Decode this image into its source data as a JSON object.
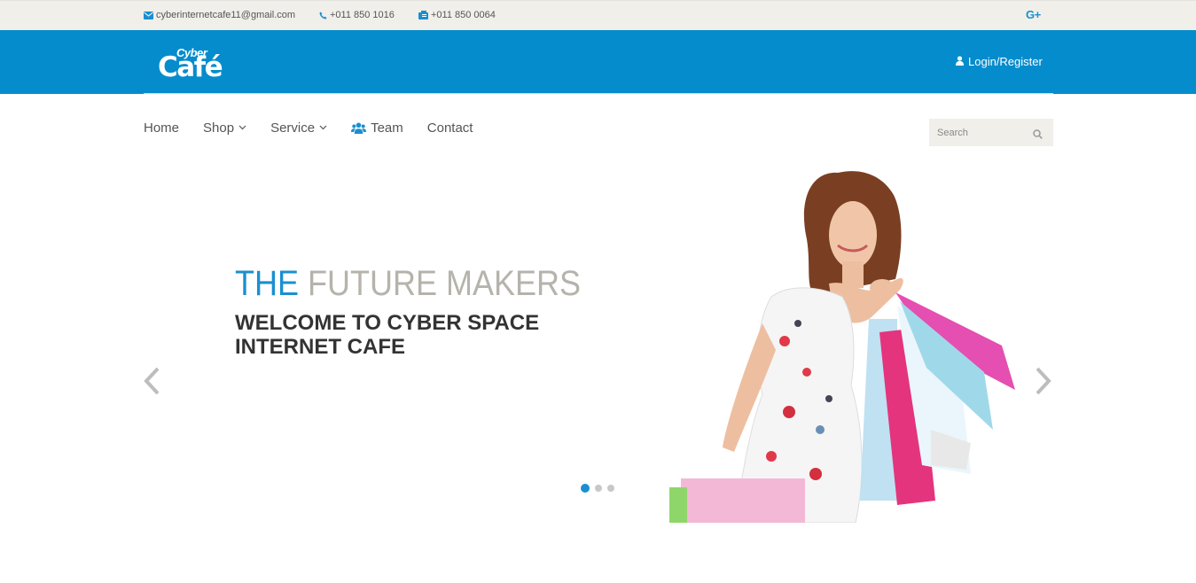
{
  "topbar": {
    "email": "cyberinternetcafe11@gmail.com",
    "phone": "+011 850 1016",
    "fax": "+011 850 0064",
    "social_icon": "google-plus-icon",
    "social_label": "G+"
  },
  "header": {
    "logo_small": "Cyber",
    "logo_big": "Café",
    "login_label": "Login/Register",
    "brand_color": "#058ccd"
  },
  "nav": {
    "items": [
      {
        "label": "Home"
      },
      {
        "label": "Shop"
      },
      {
        "label": "Service"
      },
      {
        "label": "Team"
      },
      {
        "label": "Contact"
      }
    ]
  },
  "search": {
    "placeholder": "Search",
    "value": ""
  },
  "hero": {
    "title_part1": "THE",
    "title_part2": "FUTURE MAKERS",
    "subtitle": "WELCOME TO CYBER SPACE INTERNET CAFE",
    "slides_total": 3,
    "active_slide": 1
  },
  "colors": {
    "accent": "#1a8fd0",
    "topbar_bg": "#f0efea",
    "title_grey": "#b5b3ab"
  }
}
